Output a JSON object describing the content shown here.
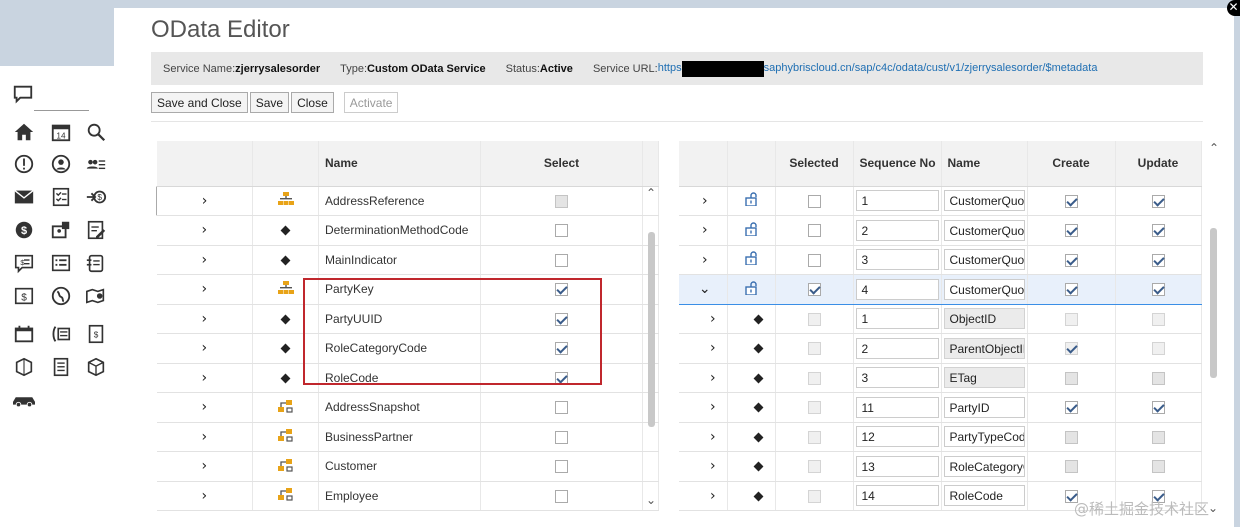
{
  "dialog": {
    "title": "OData Editor",
    "close_glyph": "✕"
  },
  "info": {
    "service_name_label": "Service Name:",
    "service_name": "zjerrysalesorder",
    "type_label": "Type:",
    "type": "Custom OData Service",
    "status_label": "Status:",
    "status": "Active",
    "url_label": "Service URL:",
    "url_prefix": "https",
    "url_suffix": "saphybriscloud.cn/sap/c4c/odata/cust/v1/zjerrysalesorder/$metadata"
  },
  "toolbar": {
    "save_close": "Save and Close",
    "save": "Save",
    "close": "Close",
    "activate": "Activate"
  },
  "left_table": {
    "headers": {
      "name": "Name",
      "select": "Select"
    },
    "rows": [
      {
        "icon": "hierarchy-icon",
        "name": "AddressReference",
        "select": "gray"
      },
      {
        "icon": "diamond-icon",
        "name": "DeterminationMethodCode",
        "select": "empty"
      },
      {
        "icon": "diamond-icon",
        "name": "MainIndicator",
        "select": "empty"
      },
      {
        "icon": "hierarchy-icon",
        "name": "PartyKey",
        "select": "checked"
      },
      {
        "icon": "diamond-icon",
        "name": "PartyUUID",
        "select": "checked"
      },
      {
        "icon": "diamond-icon",
        "name": "RoleCategoryCode",
        "select": "checked"
      },
      {
        "icon": "diamond-icon",
        "name": "RoleCode",
        "select": "checked"
      },
      {
        "icon": "association-icon",
        "name": "AddressSnapshot",
        "select": "empty"
      },
      {
        "icon": "association-icon",
        "name": "BusinessPartner",
        "select": "empty"
      },
      {
        "icon": "association-icon",
        "name": "Customer",
        "select": "empty"
      },
      {
        "icon": "association-icon",
        "name": "Employee",
        "select": "empty"
      }
    ]
  },
  "right_table": {
    "headers": {
      "selected": "Selected",
      "sequence": "Sequence No",
      "name": "Name",
      "create": "Create",
      "update": "Update"
    },
    "rows": [
      {
        "level": 0,
        "expanded": false,
        "icon": "lock-icon",
        "selected": "empty",
        "seq": "1",
        "name": "CustomerQuote",
        "create": "checked",
        "update": "checked"
      },
      {
        "level": 0,
        "expanded": false,
        "icon": "lock-icon",
        "selected": "empty",
        "seq": "2",
        "name": "CustomerQuote",
        "create": "checked",
        "update": "checked"
      },
      {
        "level": 0,
        "expanded": false,
        "icon": "lock-icon",
        "selected": "empty",
        "seq": "3",
        "name": "CustomerQuote",
        "create": "checked",
        "update": "checked"
      },
      {
        "level": 0,
        "expanded": true,
        "icon": "lock-icon",
        "selected": "checked",
        "seq": "4",
        "name": "CustomerQuote",
        "create": "checked",
        "update": "checked",
        "highlighted": true
      },
      {
        "level": 1,
        "icon": "diamond-icon",
        "selected": "disabled",
        "seq": "1",
        "name": "ObjectID",
        "readonly": true,
        "create": "disabled",
        "update": "disabled"
      },
      {
        "level": 1,
        "icon": "diamond-icon",
        "selected": "disabled",
        "seq": "2",
        "name": "ParentObjectID",
        "readonly": true,
        "create": "disabled-checked",
        "update": "disabled"
      },
      {
        "level": 1,
        "icon": "diamond-icon",
        "selected": "disabled",
        "seq": "3",
        "name": "ETag",
        "readonly": true,
        "create": "gray",
        "update": "gray"
      },
      {
        "level": 1,
        "icon": "diamond-icon",
        "selected": "disabled",
        "seq": "11",
        "name": "PartyID",
        "create": "checked",
        "update": "checked"
      },
      {
        "level": 1,
        "icon": "diamond-icon",
        "selected": "disabled",
        "seq": "12",
        "name": "PartyTypeCode",
        "create": "gray",
        "update": "gray"
      },
      {
        "level": 1,
        "icon": "diamond-icon",
        "selected": "disabled",
        "seq": "13",
        "name": "RoleCategoryC",
        "create": "gray",
        "update": "gray"
      },
      {
        "level": 1,
        "icon": "diamond-icon",
        "selected": "disabled",
        "seq": "14",
        "name": "RoleCode",
        "create": "checked",
        "update": "checked"
      }
    ]
  },
  "watermark": "@稀土掘金技术社区",
  "colors": {
    "accent": "#1f6fb3",
    "highlight_border": "#c0272d",
    "selected_row": "#3a8ee6"
  }
}
